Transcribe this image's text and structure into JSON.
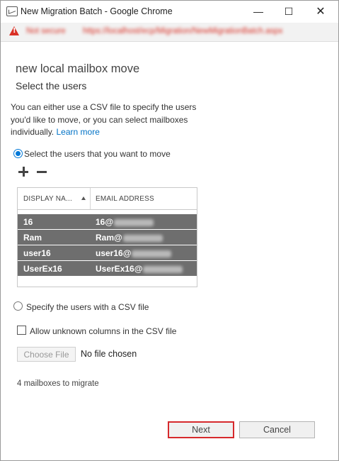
{
  "window": {
    "title": "New Migration Batch - Google Chrome",
    "controls": [
      "minimize",
      "maximize",
      "close"
    ]
  },
  "address_bar": {
    "security_label": "Not secure",
    "url": "https://localhost/ecp/Migration/NewMigrationBatch.aspx"
  },
  "page": {
    "heading": "new local mailbox move",
    "subheading": "Select the users",
    "intro_text": "You can either use a CSV file to specify the users you'd like to move, or you can select mailboxes individually.",
    "learn_more": "Learn more",
    "option_select_users": "Select the users that you want to move",
    "option_csv": "Specify the users with a CSV file",
    "allow_unknown_columns": "Allow unknown columns in the CSV file",
    "choose_file_label": "Choose File",
    "file_status": "No file chosen",
    "mailbox_count": "4 mailboxes to migrate"
  },
  "table": {
    "columns": [
      "DISPLAY NA...",
      "EMAIL ADDRESS"
    ],
    "rows": [
      {
        "display_name": "16",
        "email": "16@"
      },
      {
        "display_name": "Ram",
        "email": "Ram@"
      },
      {
        "display_name": "user16",
        "email": "user16@"
      },
      {
        "display_name": "UserEx16",
        "email": "UserEx16@"
      }
    ]
  },
  "buttons": {
    "next": "Next",
    "cancel": "Cancel"
  },
  "colors": {
    "accent": "#0078d7",
    "link": "#0072c6",
    "selected_row": "#6e6e6e",
    "highlight_border": "#d6292c",
    "warning": "#d93025"
  }
}
